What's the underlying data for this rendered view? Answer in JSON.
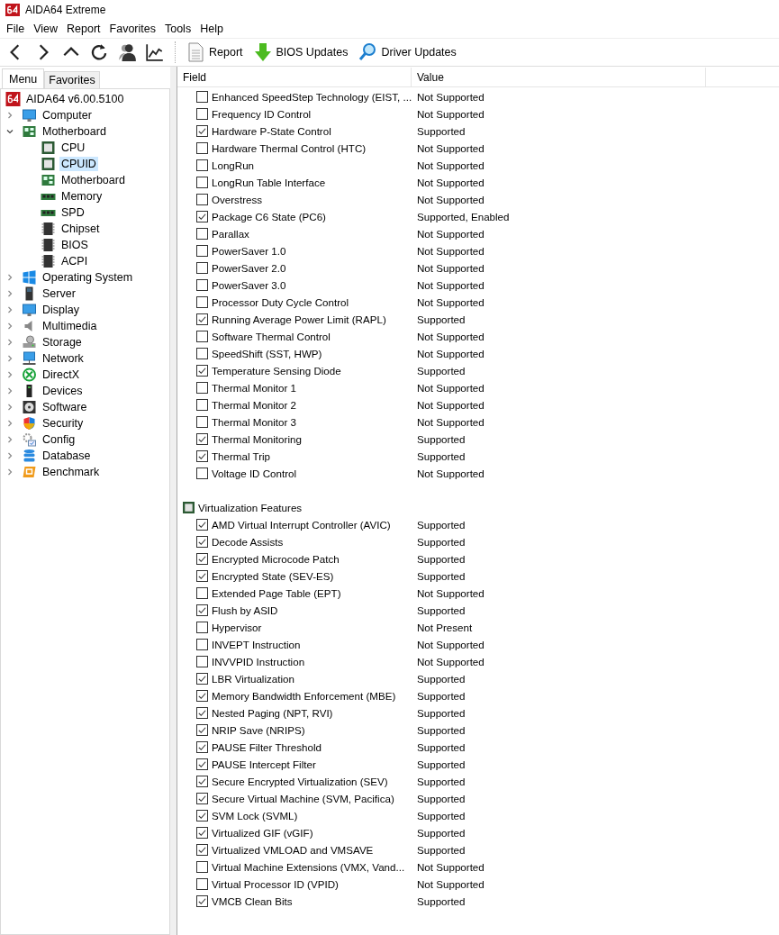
{
  "window": {
    "title": "AIDA64 Extreme"
  },
  "menu": [
    "File",
    "View",
    "Report",
    "Favorites",
    "Tools",
    "Help"
  ],
  "toolbar": [
    {
      "label": "Report"
    },
    {
      "label": "BIOS Updates"
    },
    {
      "label": "Driver Updates"
    }
  ],
  "tabs": [
    {
      "label": "Menu",
      "selected": true
    },
    {
      "label": "Favorites",
      "selected": false
    }
  ],
  "tree": {
    "root": "AIDA64 v6.00.5100",
    "items": [
      {
        "label": "Computer",
        "expanded": false
      },
      {
        "label": "Motherboard",
        "expanded": true,
        "children": [
          {
            "label": "CPU",
            "selected": false
          },
          {
            "label": "CPUID",
            "selected": true
          },
          {
            "label": "Motherboard",
            "selected": false
          },
          {
            "label": "Memory",
            "selected": false
          },
          {
            "label": "SPD",
            "selected": false
          },
          {
            "label": "Chipset",
            "selected": false
          },
          {
            "label": "BIOS",
            "selected": false
          },
          {
            "label": "ACPI",
            "selected": false
          }
        ]
      },
      {
        "label": "Operating System",
        "expanded": false
      },
      {
        "label": "Server",
        "expanded": false
      },
      {
        "label": "Display",
        "expanded": false
      },
      {
        "label": "Multimedia",
        "expanded": false
      },
      {
        "label": "Storage",
        "expanded": false
      },
      {
        "label": "Network",
        "expanded": false
      },
      {
        "label": "DirectX",
        "expanded": false
      },
      {
        "label": "Devices",
        "expanded": false
      },
      {
        "label": "Software",
        "expanded": false
      },
      {
        "label": "Security",
        "expanded": false
      },
      {
        "label": "Config",
        "expanded": false
      },
      {
        "label": "Database",
        "expanded": false
      },
      {
        "label": "Benchmark",
        "expanded": false
      }
    ]
  },
  "table": {
    "columns": [
      "Field",
      "Value"
    ],
    "sections": [
      {
        "rows": [
          {
            "field": "Enhanced SpeedStep Technology (EIST, ...",
            "value": "Not Supported",
            "checked": false
          },
          {
            "field": "Frequency ID Control",
            "value": "Not Supported",
            "checked": false
          },
          {
            "field": "Hardware P-State Control",
            "value": "Supported",
            "checked": true
          },
          {
            "field": "Hardware Thermal Control (HTC)",
            "value": "Not Supported",
            "checked": false
          },
          {
            "field": "LongRun",
            "value": "Not Supported",
            "checked": false
          },
          {
            "field": "LongRun Table Interface",
            "value": "Not Supported",
            "checked": false
          },
          {
            "field": "Overstress",
            "value": "Not Supported",
            "checked": false
          },
          {
            "field": "Package C6 State (PC6)",
            "value": "Supported, Enabled",
            "checked": true
          },
          {
            "field": "Parallax",
            "value": "Not Supported",
            "checked": false
          },
          {
            "field": "PowerSaver 1.0",
            "value": "Not Supported",
            "checked": false
          },
          {
            "field": "PowerSaver 2.0",
            "value": "Not Supported",
            "checked": false
          },
          {
            "field": "PowerSaver 3.0",
            "value": "Not Supported",
            "checked": false
          },
          {
            "field": "Processor Duty Cycle Control",
            "value": "Not Supported",
            "checked": false
          },
          {
            "field": "Running Average Power Limit (RAPL)",
            "value": "Supported",
            "checked": true
          },
          {
            "field": "Software Thermal Control",
            "value": "Not Supported",
            "checked": false
          },
          {
            "field": "SpeedShift (SST, HWP)",
            "value": "Not Supported",
            "checked": false
          },
          {
            "field": "Temperature Sensing Diode",
            "value": "Supported",
            "checked": true
          },
          {
            "field": "Thermal Monitor 1",
            "value": "Not Supported",
            "checked": false
          },
          {
            "field": "Thermal Monitor 2",
            "value": "Not Supported",
            "checked": false
          },
          {
            "field": "Thermal Monitor 3",
            "value": "Not Supported",
            "checked": false
          },
          {
            "field": "Thermal Monitoring",
            "value": "Supported",
            "checked": true
          },
          {
            "field": "Thermal Trip",
            "value": "Supported",
            "checked": true
          },
          {
            "field": "Voltage ID Control",
            "value": "Not Supported",
            "checked": false
          }
        ]
      },
      {
        "title": "Virtualization Features",
        "rows": [
          {
            "field": "AMD Virtual Interrupt Controller (AVIC)",
            "value": "Supported",
            "checked": true
          },
          {
            "field": "Decode Assists",
            "value": "Supported",
            "checked": true
          },
          {
            "field": "Encrypted Microcode Patch",
            "value": "Supported",
            "checked": true
          },
          {
            "field": "Encrypted State (SEV-ES)",
            "value": "Supported",
            "checked": true
          },
          {
            "field": "Extended Page Table (EPT)",
            "value": "Not Supported",
            "checked": false
          },
          {
            "field": "Flush by ASID",
            "value": "Supported",
            "checked": true
          },
          {
            "field": "Hypervisor",
            "value": "Not Present",
            "checked": false
          },
          {
            "field": "INVEPT Instruction",
            "value": "Not Supported",
            "checked": false
          },
          {
            "field": "INVVPID Instruction",
            "value": "Not Supported",
            "checked": false
          },
          {
            "field": "LBR Virtualization",
            "value": "Supported",
            "checked": true
          },
          {
            "field": "Memory Bandwidth Enforcement (MBE)",
            "value": "Supported",
            "checked": true
          },
          {
            "field": "Nested Paging (NPT, RVI)",
            "value": "Supported",
            "checked": true
          },
          {
            "field": "NRIP Save (NRIPS)",
            "value": "Supported",
            "checked": true
          },
          {
            "field": "PAUSE Filter Threshold",
            "value": "Supported",
            "checked": true
          },
          {
            "field": "PAUSE Intercept Filter",
            "value": "Supported",
            "checked": true
          },
          {
            "field": "Secure Encrypted Virtualization (SEV)",
            "value": "Supported",
            "checked": true
          },
          {
            "field": "Secure Virtual Machine (SVM, Pacifica)",
            "value": "Supported",
            "checked": true
          },
          {
            "field": "SVM Lock (SVML)",
            "value": "Supported",
            "checked": true
          },
          {
            "field": "Virtualized GIF (vGIF)",
            "value": "Supported",
            "checked": true
          },
          {
            "field": "Virtualized VMLOAD and VMSAVE",
            "value": "Supported",
            "checked": true
          },
          {
            "field": "Virtual Machine Extensions (VMX, Vand...",
            "value": "Not Supported",
            "checked": false
          },
          {
            "field": "Virtual Processor ID (VPID)",
            "value": "Not Supported",
            "checked": false
          },
          {
            "field": "VMCB Clean Bits",
            "value": "Supported",
            "checked": true
          }
        ]
      }
    ]
  }
}
